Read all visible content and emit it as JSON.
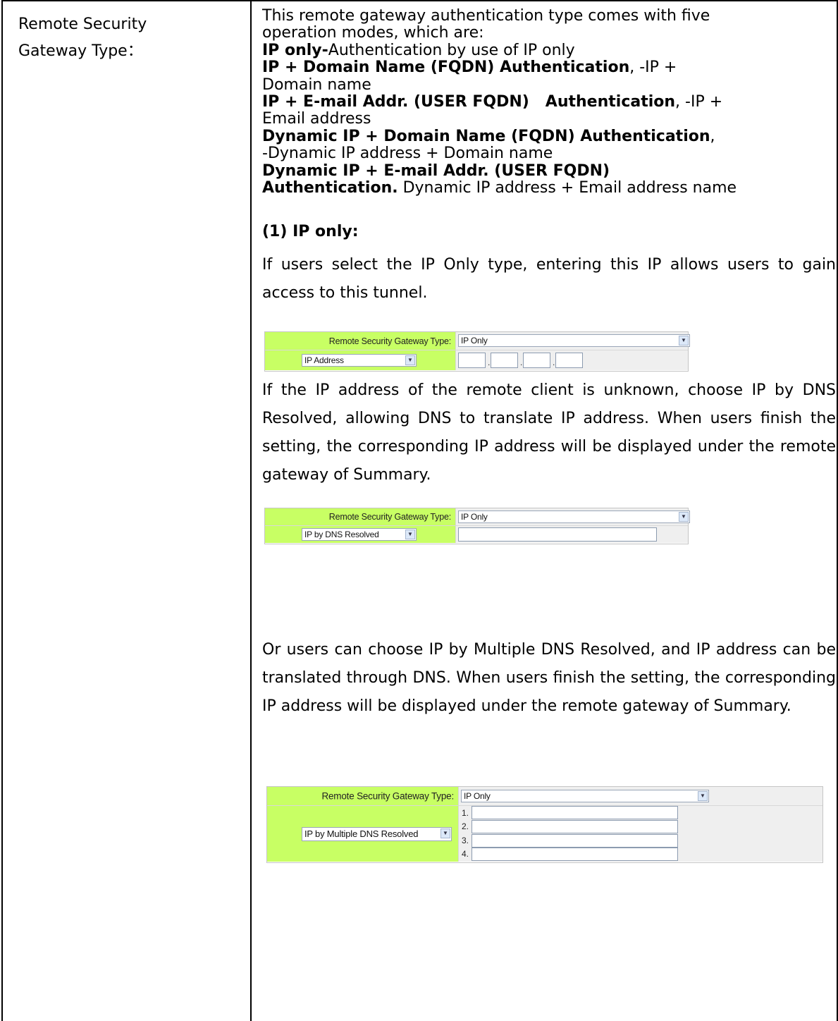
{
  "left_label": {
    "line1": "Remote Security",
    "line2": "Gateway Type："
  },
  "intro": {
    "l1": "This remote gateway authentication type comes with five",
    "l2": "operation modes, which are:",
    "l3_bold": "IP only-",
    "l3_rest": "Authentication by use of IP only",
    "l4_bold": "IP + Domain Name (FQDN) Authentication",
    "l4_rest": ", -IP +",
    "l5": "Domain name",
    "l6_bold": "IP + E-mail Addr. (USER FQDN)   Authentication",
    "l6_rest": ", -IP +",
    "l7": "Email address",
    "l8_bold": "Dynamic IP + Domain Name (FQDN) Authentication",
    "l8_rest": ",",
    "l9": "-Dynamic IP address + Domain name",
    "l10_bold": "Dynamic IP + E-mail Addr. (USER FQDN)",
    "l11_bold": "Authentication.",
    "l11_rest": " Dynamic IP address + Email address name"
  },
  "section_heading": "(1) IP only:",
  "paragraphs": {
    "p1": "If users select the IP Only type, entering this IP allows users to gain access to this tunnel.",
    "p2": "If the IP address of the remote client is unknown, choose IP by DNS Resolved, allowing DNS to translate IP address. When users finish the setting, the corresponding IP address will be displayed under the remote gateway of Summary.",
    "p3": "Or users can choose IP by Multiple DNS Resolved, and IP address can be translated through DNS. When users finish the setting, the corresponding IP address will be displayed under the remote gateway of Summary."
  },
  "screenshot1": {
    "label": "Remote Security Gateway Type:",
    "type_value": "IP Only",
    "mode_value": "IP Address",
    "ip_octets": [
      "",
      "",
      "",
      ""
    ]
  },
  "screenshot2": {
    "label": "Remote Security Gateway Type:",
    "type_value": "IP Only",
    "mode_value": "IP by DNS Resolved",
    "host_value": ""
  },
  "screenshot3": {
    "label": "Remote Security Gateway Type:",
    "type_value": "IP Only",
    "mode_value": "IP by Multiple DNS Resolved",
    "entries": [
      {
        "num": "1.",
        "value": ""
      },
      {
        "num": "2.",
        "value": ""
      },
      {
        "num": "3.",
        "value": ""
      },
      {
        "num": "4.",
        "value": ""
      }
    ]
  },
  "icons": {
    "dropdown": "chevron-down-icon"
  },
  "colors": {
    "label_bg": "#c8ff64",
    "value_bg": "#efefef",
    "border": "#000000"
  }
}
